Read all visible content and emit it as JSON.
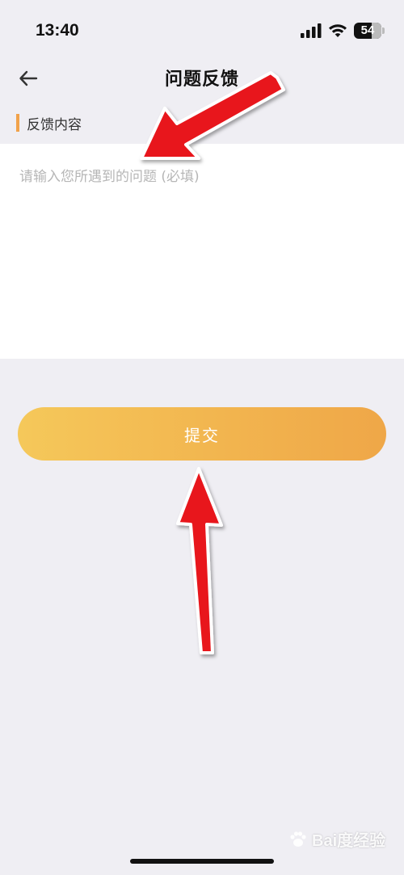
{
  "status_bar": {
    "time": "13:40",
    "battery": "54",
    "icons": [
      "signal-icon",
      "wifi-icon",
      "battery-icon"
    ]
  },
  "nav": {
    "title": "问题反馈",
    "back_icon": "arrow-left-icon"
  },
  "form": {
    "section_label": "反馈内容",
    "feedback_value": "",
    "feedback_placeholder": "请输入您所遇到的问题 (必填)",
    "submit_label": "提交"
  },
  "watermark": {
    "text": "Bai度经验"
  },
  "colors": {
    "background": "#efeef3",
    "accent": "#f1a24a",
    "button_gradient_start": "#f5c85a",
    "button_gradient_end": "#efa748",
    "annotation_arrow": "#e8141b"
  }
}
